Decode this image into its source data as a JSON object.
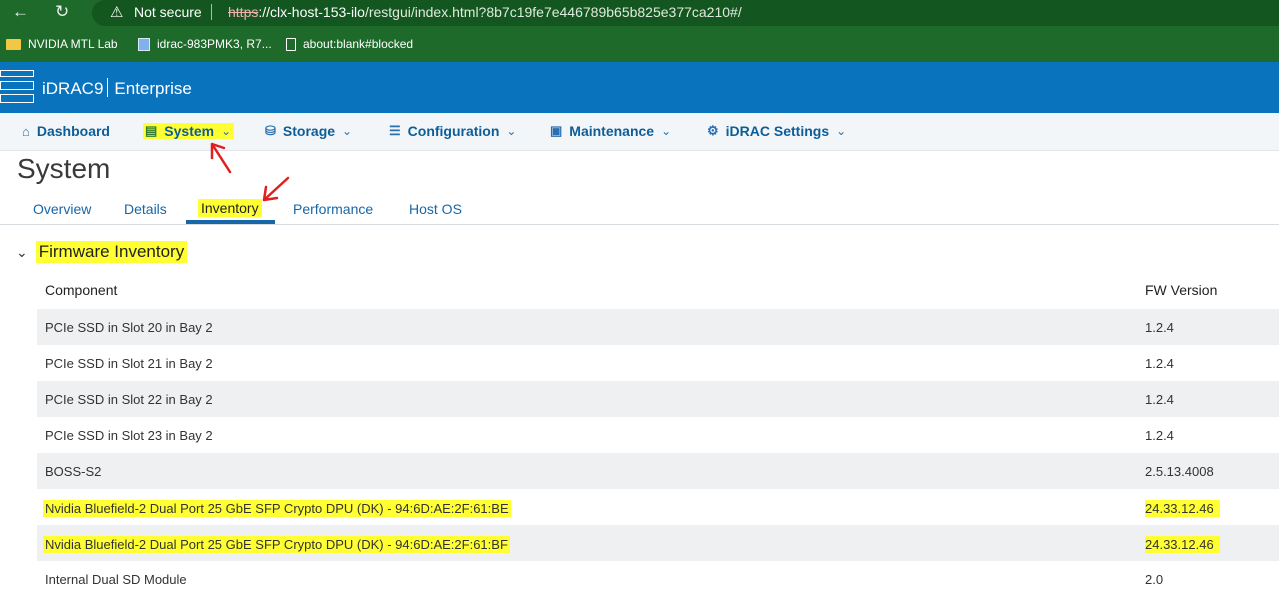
{
  "browser": {
    "security_label": "Not secure",
    "url_scheme": "https",
    "url_host": "://clx-host-153-ilo",
    "url_path": "/restgui/index.html?8b7c19fe7e446789b65b825e377ca210#/",
    "bookmarks": [
      {
        "label": "NVIDIA MTL Lab",
        "icon": "folder-icon"
      },
      {
        "label": "idrac-983PMK3, R7...",
        "icon": "server-icon"
      },
      {
        "label": "about:blank#blocked",
        "icon": "page-icon"
      }
    ]
  },
  "header": {
    "product": "iDRAC9",
    "edition": "Enterprise"
  },
  "nav": {
    "items": [
      {
        "label": "Dashboard",
        "icon": "home-icon"
      },
      {
        "label": "System",
        "icon": "server-icon"
      },
      {
        "label": "Storage",
        "icon": "database-icon"
      },
      {
        "label": "Configuration",
        "icon": "sliders-icon"
      },
      {
        "label": "Maintenance",
        "icon": "image-icon"
      },
      {
        "label": "iDRAC Settings",
        "icon": "gears-icon"
      }
    ]
  },
  "page": {
    "title": "System",
    "tabs": [
      "Overview",
      "Details",
      "Inventory",
      "Performance",
      "Host OS"
    ],
    "active_tab": "Inventory"
  },
  "section": {
    "title": "Firmware Inventory",
    "columns": [
      "Component",
      "FW Version"
    ],
    "rows": [
      {
        "component": "PCIe SSD in Slot 20 in Bay 2",
        "version": "1.2.4"
      },
      {
        "component": "PCIe SSD in Slot 21 in Bay 2",
        "version": "1.2.4"
      },
      {
        "component": "PCIe SSD in Slot 22 in Bay 2",
        "version": "1.2.4"
      },
      {
        "component": "PCIe SSD in Slot 23 in Bay 2",
        "version": "1.2.4"
      },
      {
        "component": "BOSS-S2",
        "version": "2.5.13.4008"
      },
      {
        "component": "Nvidia Bluefield-2 Dual Port 25 GbE SFP Crypto DPU (DK) - 94:6D:AE:2F:61:BE",
        "version": "24.33.12.46"
      },
      {
        "component": "Nvidia Bluefield-2 Dual Port 25 GbE SFP Crypto DPU (DK) - 94:6D:AE:2F:61:BF",
        "version": "24.33.12.46"
      },
      {
        "component": "Internal Dual SD Module",
        "version": "2.0"
      }
    ]
  },
  "colors": {
    "browser_bar": "#1e6a2a",
    "header_blue": "#0a73bd",
    "nav_text": "#0d5d98",
    "highlight": "#ffff33",
    "annotation_red": "#e02020"
  }
}
